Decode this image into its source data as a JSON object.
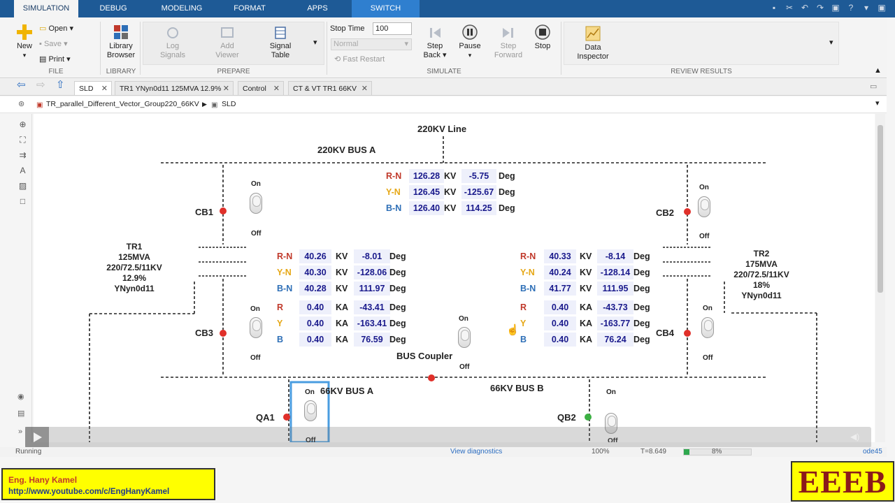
{
  "tabs": [
    "SIMULATION",
    "DEBUG",
    "MODELING",
    "FORMAT",
    "APPS",
    "SWITCH"
  ],
  "ribbon": {
    "file": {
      "new": "New",
      "open": "Open",
      "save": "Save",
      "print": "Print",
      "label": "FILE"
    },
    "library": {
      "browser_line1": "Library",
      "browser_line2": "Browser",
      "label": "LIBRARY"
    },
    "prepare": {
      "log_line1": "Log",
      "log_line2": "Signals",
      "add_line1": "Add",
      "add_line2": "Viewer",
      "signal_line1": "Signal",
      "signal_line2": "Table",
      "label": "PREPARE"
    },
    "simulate": {
      "stop_time_label": "Stop Time",
      "stop_time_value": "100",
      "mode": "Normal",
      "fast_restart": "Fast Restart",
      "step_back_line1": "Step",
      "step_back_line2": "Back",
      "pause": "Pause",
      "step_fwd_line1": "Step",
      "step_fwd_line2": "Forward",
      "stop": "Stop",
      "label": "SIMULATE"
    },
    "review": {
      "inspector_line1": "Data",
      "inspector_line2": "Inspector",
      "label": "REVIEW RESULTS"
    }
  },
  "doc_tabs": [
    "SLD",
    "TR1 YNyn0d11 125MVA 12.9%",
    "Control",
    "CT & VT TR1 66KV"
  ],
  "breadcrumb": {
    "model": "TR_parallel_Different_Vector_Group220_66KV",
    "subsystem": "SLD"
  },
  "diagram": {
    "line_220": "220KV Line",
    "bus_220a": "220KV BUS A",
    "bus_66a": "66KV BUS A",
    "bus_66b": "66KV BUS B",
    "bus_coupler": "BUS Coupler",
    "on": "On",
    "off": "Off",
    "breakers": {
      "cb1": "CB1",
      "cb2": "CB2",
      "cb3": "CB3",
      "cb4": "CB4",
      "qa1": "QA1",
      "qb2": "QB2"
    },
    "tr1": {
      "name": "TR1",
      "mva": "125MVA",
      "kv": "220/72.5/11KV",
      "z": "12.9%",
      "vg": "YNyn0d11"
    },
    "tr2": {
      "name": "TR2",
      "mva": "175MVA",
      "kv": "220/72.5/11KV",
      "z": "18%",
      "vg": "YNyn0d11"
    },
    "units": {
      "kv": "KV",
      "ka": "KA",
      "deg": "Deg"
    },
    "line_voltages": [
      {
        "phase": "R-N",
        "mag": "126.28",
        "ang": "-5.75"
      },
      {
        "phase": "Y-N",
        "mag": "126.45",
        "ang": "-125.67"
      },
      {
        "phase": "B-N",
        "mag": "126.40",
        "ang": "114.25"
      }
    ],
    "tr1_voltages": [
      {
        "phase": "R-N",
        "mag": "40.26",
        "ang": "-8.01"
      },
      {
        "phase": "Y-N",
        "mag": "40.30",
        "ang": "-128.06"
      },
      {
        "phase": "B-N",
        "mag": "40.28",
        "ang": "111.97"
      }
    ],
    "tr1_currents": [
      {
        "phase": "R",
        "mag": "0.40",
        "ang": "-43.41"
      },
      {
        "phase": "Y",
        "mag": "0.40",
        "ang": "-163.41"
      },
      {
        "phase": "B",
        "mag": "0.40",
        "ang": "76.59"
      }
    ],
    "tr2_voltages": [
      {
        "phase": "R-N",
        "mag": "40.33",
        "ang": "-8.14"
      },
      {
        "phase": "Y-N",
        "mag": "40.24",
        "ang": "-128.14"
      },
      {
        "phase": "B-N",
        "mag": "41.77",
        "ang": "111.95"
      }
    ],
    "tr2_currents": [
      {
        "phase": "R",
        "mag": "0.40",
        "ang": "-43.73"
      },
      {
        "phase": "Y",
        "mag": "0.40",
        "ang": "-163.77"
      },
      {
        "phase": "B",
        "mag": "0.40",
        "ang": "76.24"
      }
    ]
  },
  "status": {
    "state": "Running",
    "diagnostics": "View diagnostics",
    "zoom": "100%",
    "time": "T=8.649",
    "progress_text": "8%",
    "progress": 0.08,
    "solver": "ode45"
  },
  "banner": {
    "name": "Eng. Hany Kamel",
    "url": "http://www.youtube.com/c/EngHanyKamel",
    "logo": "EEEB"
  },
  "colors": {
    "tab_bar": "#1e5a96",
    "switch_tab": "#2f7fcf",
    "value_text": "#1a1a8c",
    "phase_r": "#c0392b",
    "phase_y": "#e6a817",
    "phase_b": "#2e6fb7",
    "breaker_closed": "#e0302a",
    "breaker_green": "#3cb043"
  }
}
